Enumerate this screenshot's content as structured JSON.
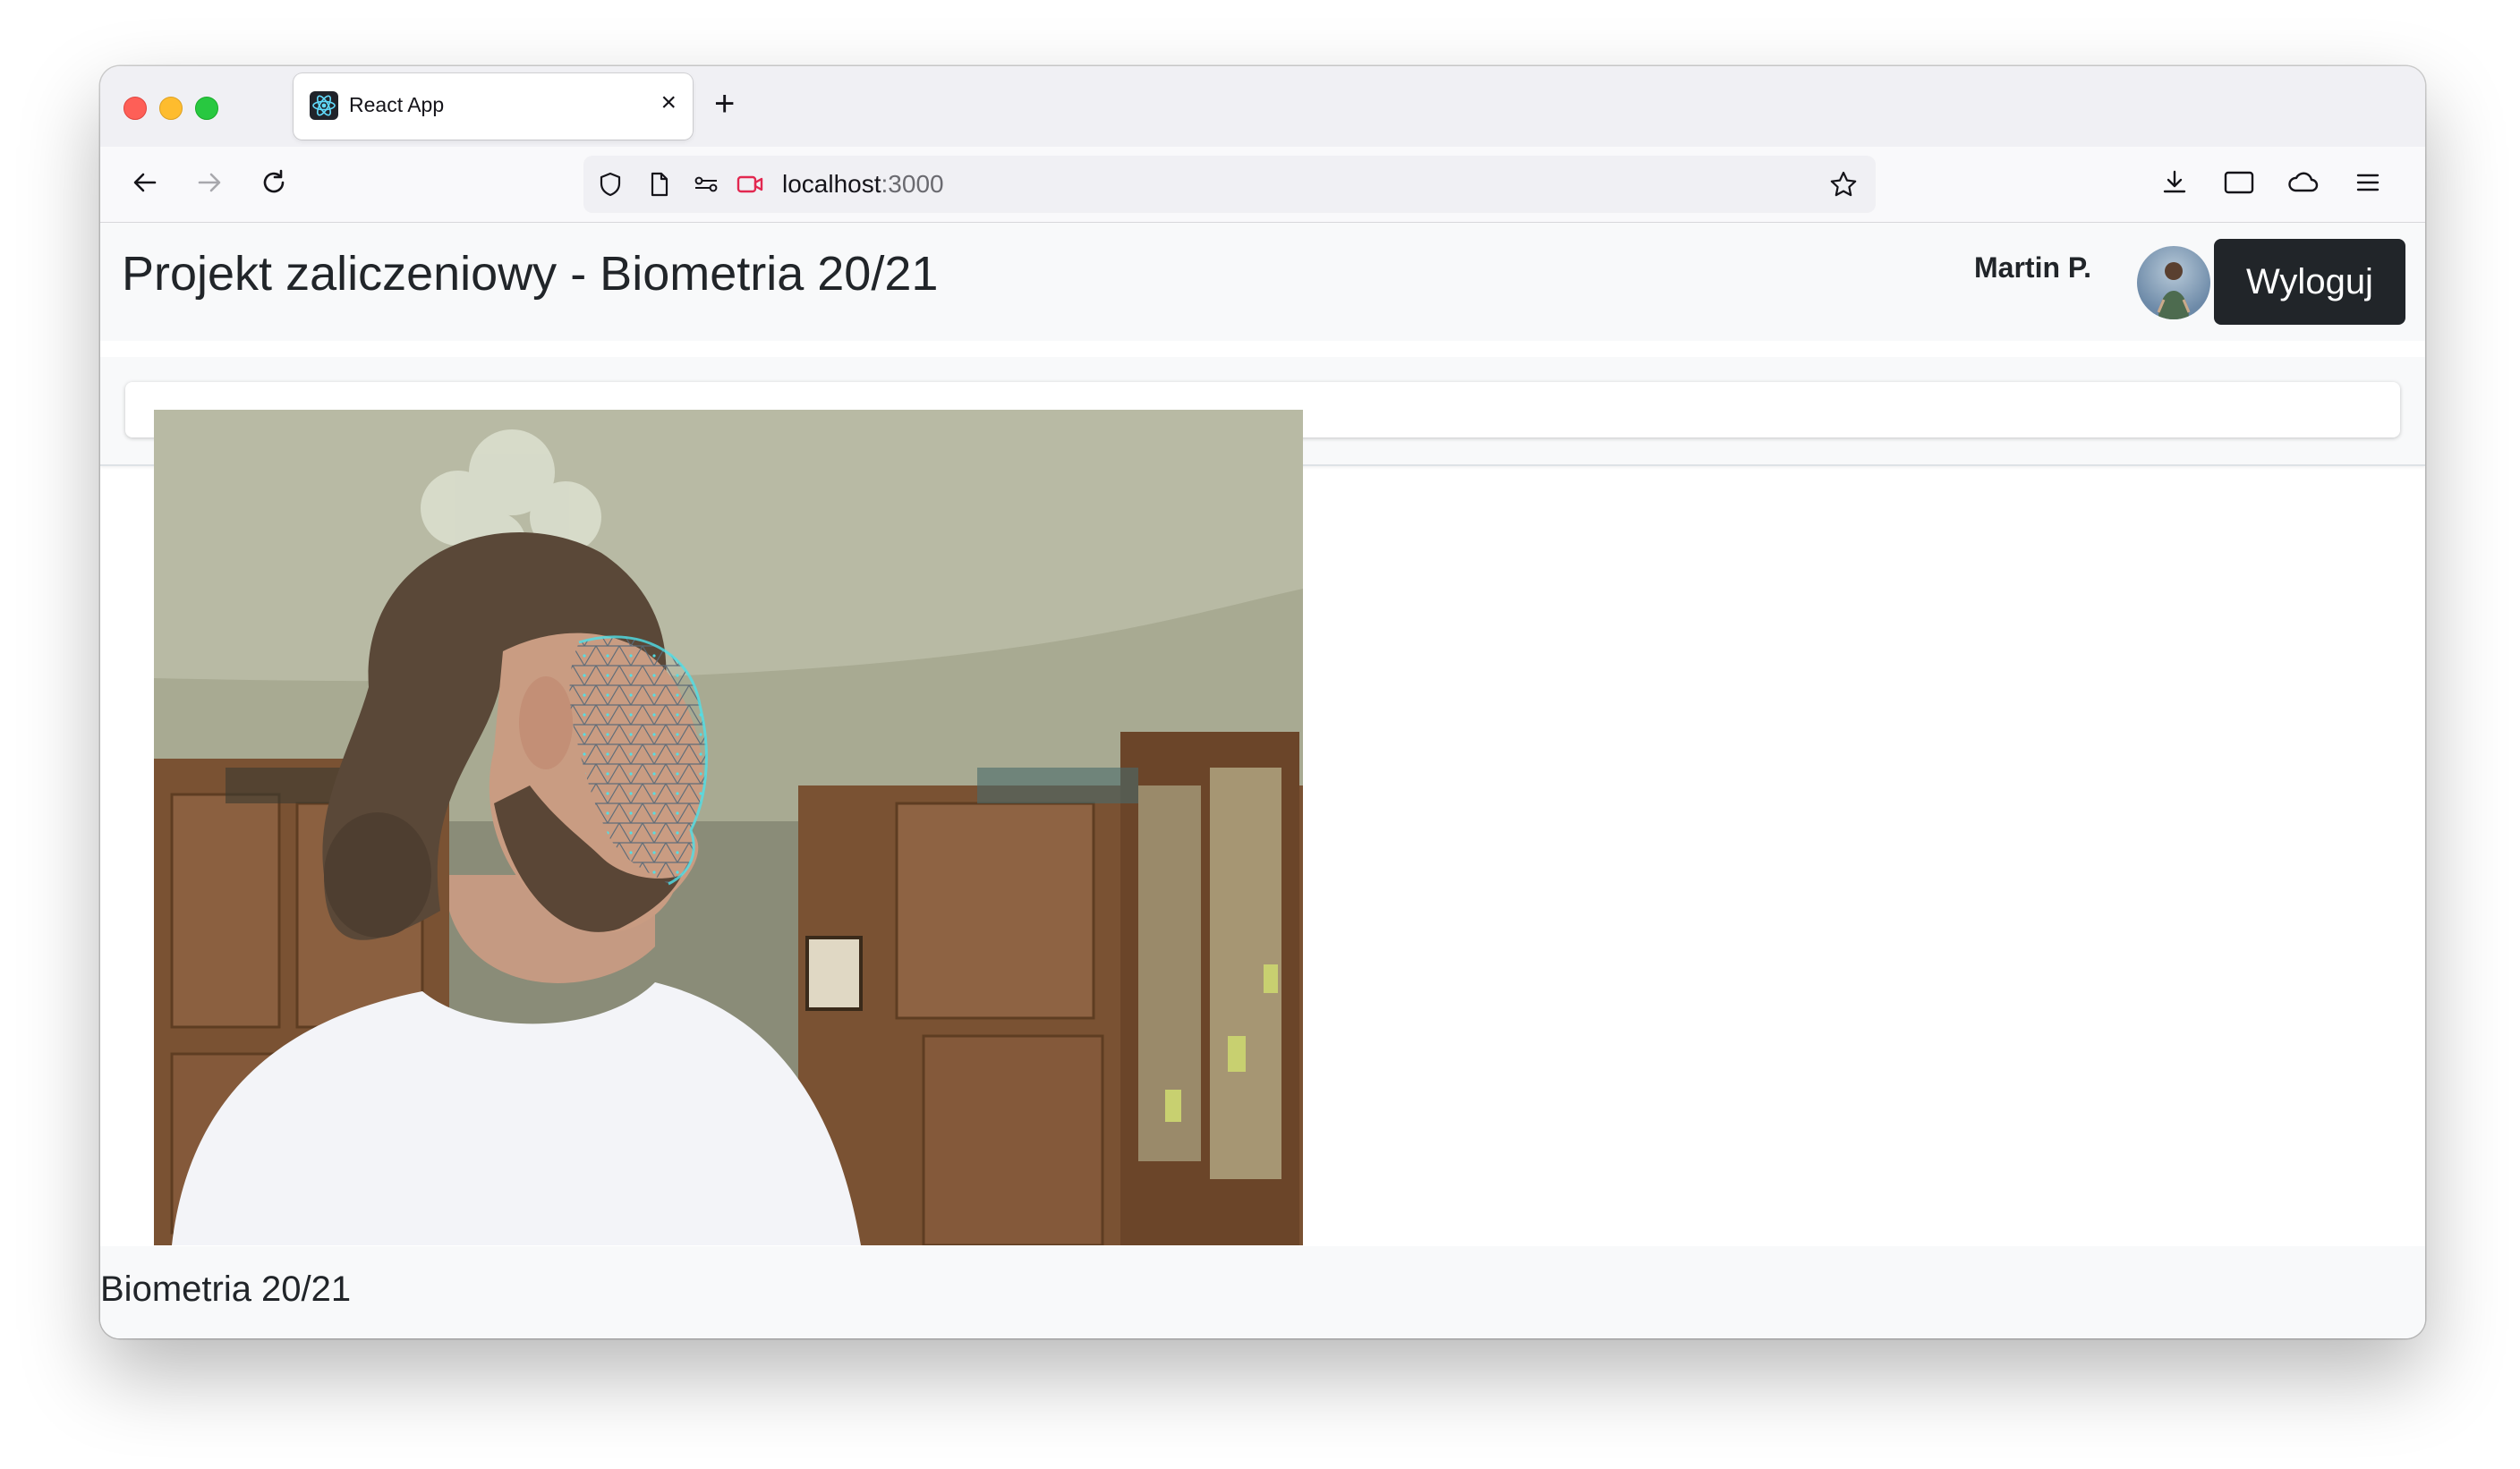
{
  "browser": {
    "tab_title": "React App",
    "tab_close": "×",
    "new_tab": "+",
    "url_host": "localhost",
    "url_port": ":3000"
  },
  "app": {
    "title": "Projekt zaliczeniowy - Biometria 20/21",
    "user_name": "Martin P.",
    "logout_label": "Wyloguj",
    "footer": "Biometria 20/21"
  },
  "colors": {
    "header_bg": "#f8f9fa",
    "button_bg": "#212529",
    "mesh": "#4fe0e8"
  }
}
